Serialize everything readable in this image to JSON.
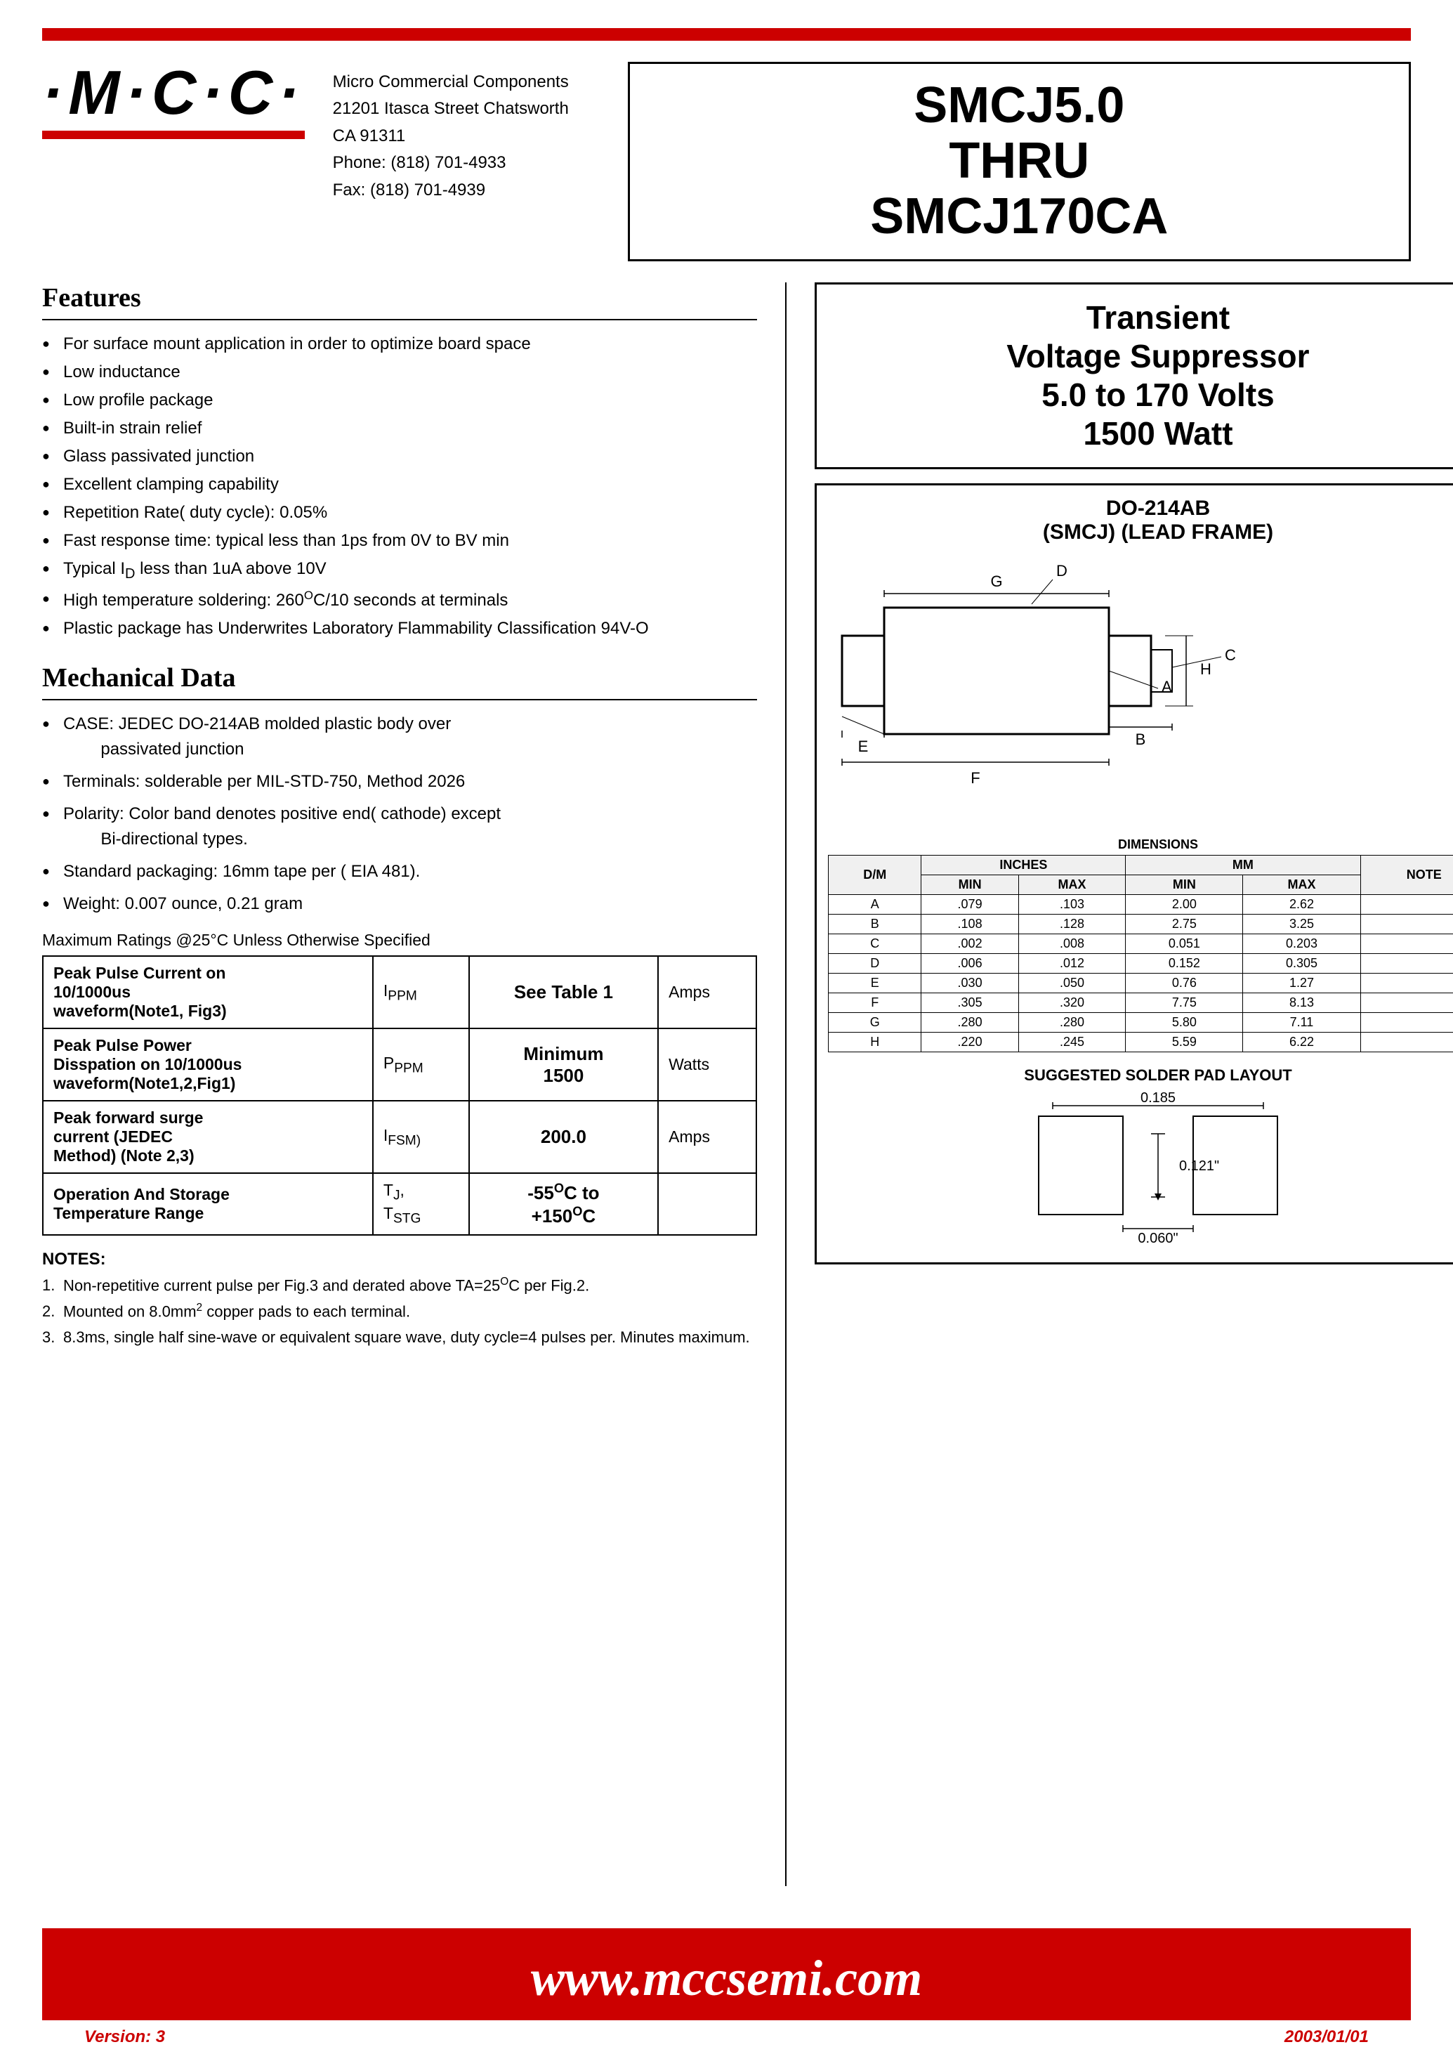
{
  "header": {
    "logo": "·M·C·C·",
    "company_name": "Micro Commercial Components",
    "address1": "21201 Itasca Street Chatsworth",
    "address2": "CA 91311",
    "phone": "Phone: (818) 701-4933",
    "fax": "Fax:    (818) 701-4939",
    "part_number": "SMCJ5.0\nTHRU\nSMCJ170CA"
  },
  "transient": {
    "title": "Transient\nVoltage Suppressor\n5.0 to 170 Volts\n1500 Watt"
  },
  "package": {
    "title_line1": "DO-214AB",
    "title_line2": "(SMCJ) (LEAD FRAME)"
  },
  "features": {
    "section_title": "Features",
    "items": [
      "For surface mount application in order to optimize board space",
      "Low inductance",
      "Low profile package",
      "Built-in strain relief",
      "Glass passivated junction",
      "Excellent clamping capability",
      "Repetition Rate( duty cycle): 0.05%",
      "Fast response time: typical less than 1ps from 0V to BV min",
      "Typical I₀ less than 1uA above 10V",
      "High temperature soldering: 260°C/10 seconds at terminals",
      "Plastic package has Underwrites Laboratory Flammability Classification 94V-O"
    ]
  },
  "mechanical": {
    "section_title": "Mechanical Data",
    "items": [
      "CASE: JEDEC DO-214AB molded plastic body over passivated junction",
      "Terminals:  solderable per MIL-STD-750, Method 2026",
      "Polarity: Color band denotes positive end( cathode) except Bi-directional types.",
      "Standard packaging: 16mm tape per ( EIA 481).",
      "Weight: 0.007 ounce, 0.21 gram"
    ],
    "max_ratings_note": "Maximum Ratings @25°C Unless Otherwise Specified"
  },
  "ratings_table": {
    "rows": [
      {
        "param": "Peak Pulse Current on 10/1000us waveform(Note1, Fig3)",
        "symbol": "Iₚₚₘ",
        "value": "See Table 1",
        "unit": "Amps"
      },
      {
        "param": "Peak Pulse Power Disspation on 10/1000us waveform(Note1,2,Fig1)",
        "symbol": "Pₚₚₘ",
        "value": "Minimum\n1500",
        "unit": "Watts"
      },
      {
        "param": "Peak forward surge current (JEDEC Method) (Note 2,3)",
        "symbol": "IⱠ(FSM)",
        "value": "200.0",
        "unit": "Amps"
      },
      {
        "param": "Operation And Storage Temperature Range",
        "symbol": "TJ, TSTG",
        "value": "-55°C to +150°C",
        "unit": ""
      }
    ]
  },
  "notes": {
    "title": "NOTES:",
    "items": [
      "Non-repetitive current pulse per Fig.3 and derated above TA=25°C per Fig.2.",
      "Mounted on 8.0mm² copper pads to each terminal.",
      "8.3ms, single half sine-wave or equivalent square wave, duty cycle=4 pulses per. Minutes maximum."
    ]
  },
  "dimensions_table": {
    "header": [
      "D/M",
      "MIN",
      "MAX",
      "MIN",
      "MAX",
      "NOTE"
    ],
    "sub_header": [
      "",
      "INCHES",
      "",
      "MM",
      "",
      ""
    ],
    "rows": [
      [
        "A",
        ".079",
        ".103",
        "2.00",
        "2.62",
        ""
      ],
      [
        "B",
        ".108",
        ".128",
        "2.75",
        "3.25",
        ""
      ],
      [
        "C",
        ".002",
        ".008",
        "0.051",
        "0.203",
        ""
      ],
      [
        "D",
        ".006",
        ".012",
        "0.152",
        "0.305",
        ""
      ],
      [
        "E",
        ".030",
        ".050",
        "0.76",
        "1.27",
        ""
      ],
      [
        "F",
        ".305",
        ".320",
        "7.75",
        "8.13",
        ""
      ],
      [
        "G",
        ".280",
        ".280",
        "5.80",
        "7.11",
        ""
      ],
      [
        "H",
        ".220",
        ".245",
        "5.59",
        "6.22",
        ""
      ]
    ]
  },
  "solder": {
    "title": "SUGGESTED SOLDER PAD LAYOUT",
    "dim1": "0.185",
    "dim2": "0.121\"",
    "dim3": "0.060\""
  },
  "footer": {
    "website": "www.mccsemi.com",
    "version": "Version: 3",
    "date": "2003/01/01"
  }
}
